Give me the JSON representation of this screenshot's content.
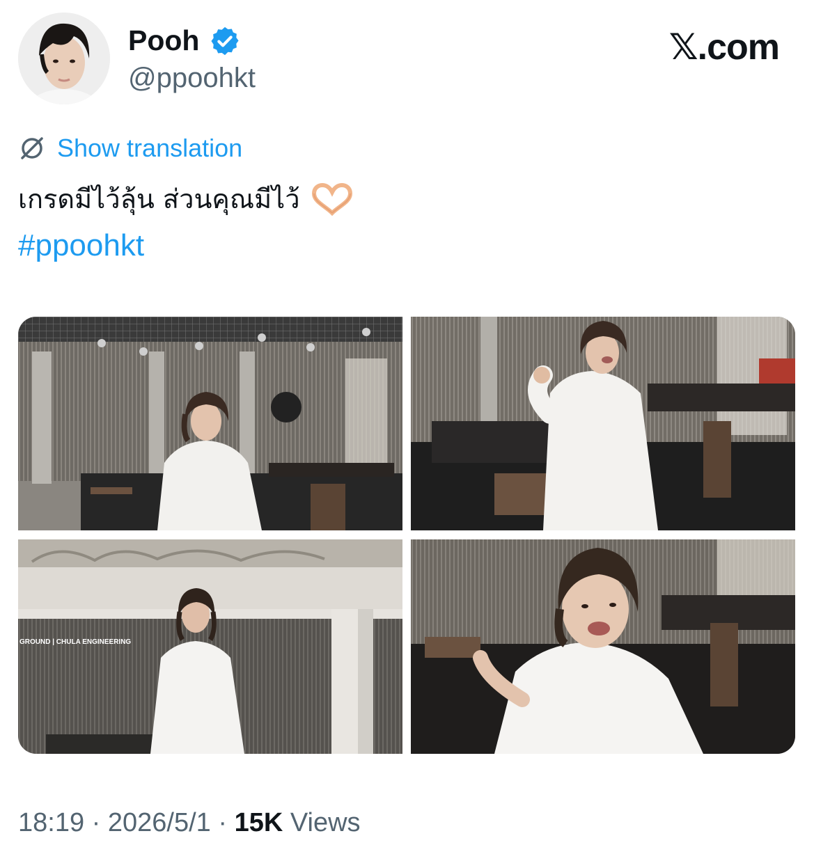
{
  "author": {
    "display_name": "Pooh",
    "handle": "@ppoohkt",
    "verified": true,
    "avatar_icon": "profile-photo"
  },
  "site": {
    "logo_text": "𝕏.com"
  },
  "translation": {
    "label": "Show translation",
    "icon": "translate-globe-icon"
  },
  "post": {
    "text": "เกรดมีไว้ลุ้น ส่วนคุณมีไว้",
    "emoji": "heart-hands-emoji",
    "hashtag": "#ppoohkt"
  },
  "media": {
    "photos": [
      {
        "name": "photo-1"
      },
      {
        "name": "photo-2"
      },
      {
        "name": "photo-3",
        "sign_text": "GROUND | CHULA ENGINEERING"
      },
      {
        "name": "photo-4"
      }
    ]
  },
  "meta": {
    "time": "18:19",
    "date": "2026/5/1",
    "views_count": "15K",
    "views_label": "Views",
    "separator": "·"
  },
  "colors": {
    "accent": "#1d9bf0",
    "text_primary": "#0f1419",
    "text_secondary": "#536471"
  }
}
